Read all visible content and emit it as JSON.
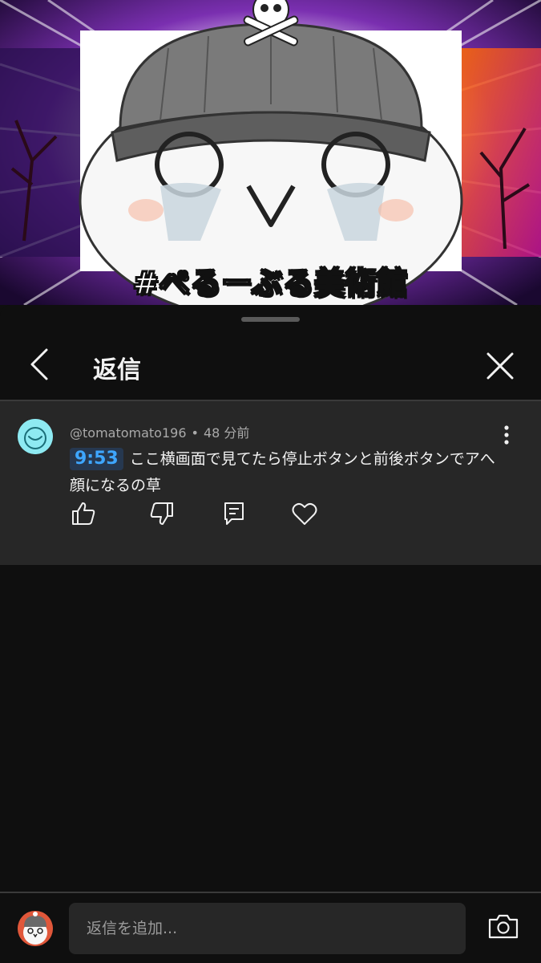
{
  "video": {
    "caption": "#ぺるーぶる美術館"
  },
  "header": {
    "title": "返信",
    "back_icon": "chevron-left-icon",
    "close_icon": "close-icon"
  },
  "comment": {
    "author": "@tomatomato196",
    "separator": "•",
    "time_ago": "48 分前",
    "timestamp_link": "9:53",
    "text": "ここ横画面で見てたら停止ボタンと前後ボタンでアへ顔になるの草",
    "actions": [
      "like-icon",
      "dislike-icon",
      "reply-icon",
      "heart-icon"
    ]
  },
  "reply_bar": {
    "placeholder": "返信を追加..."
  },
  "colors": {
    "background": "#0f0f0f",
    "comment_bg": "#272727",
    "link_blue": "#3ea6ff",
    "avatar_cyan": "#8eeaf2"
  }
}
